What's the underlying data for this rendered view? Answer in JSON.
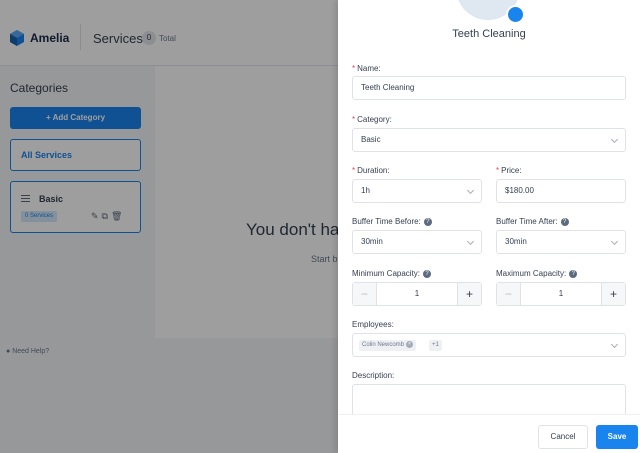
{
  "header": {
    "logo_text": "Amelia",
    "page_title": "Services",
    "total_count": "0",
    "total_label": "Total"
  },
  "sidebar": {
    "title": "Categories",
    "add_button": "+ Add Category",
    "all_services": "All Services",
    "category": {
      "name": "Basic",
      "services_badge": "0 Services"
    }
  },
  "main": {
    "empty_title": "You don't ha",
    "empty_subtitle": "Start b"
  },
  "help_text": "Need Help?",
  "dialog": {
    "title": "Teeth Cleaning",
    "name": {
      "label": "Name:",
      "value": "Teeth Cleaning"
    },
    "category": {
      "label": "Category:",
      "value": "Basic"
    },
    "duration": {
      "label": "Duration:",
      "value": "1h"
    },
    "price": {
      "label": "Price:",
      "value": "$180.00"
    },
    "buffer_before": {
      "label": "Buffer Time Before:",
      "value": "30min"
    },
    "buffer_after": {
      "label": "Buffer Time After:",
      "value": "30min"
    },
    "min_capacity": {
      "label": "Minimum Capacity:",
      "value": "1"
    },
    "max_capacity": {
      "label": "Maximum Capacity:",
      "value": "1"
    },
    "employees": {
      "label": "Employees:",
      "tag": "Colin Newcomb",
      "more": "+1"
    },
    "description": {
      "label": "Description:"
    },
    "cancel": "Cancel",
    "save": "Save"
  },
  "colors": {
    "accent": "#1a84ee",
    "required": "#e04a4a"
  }
}
